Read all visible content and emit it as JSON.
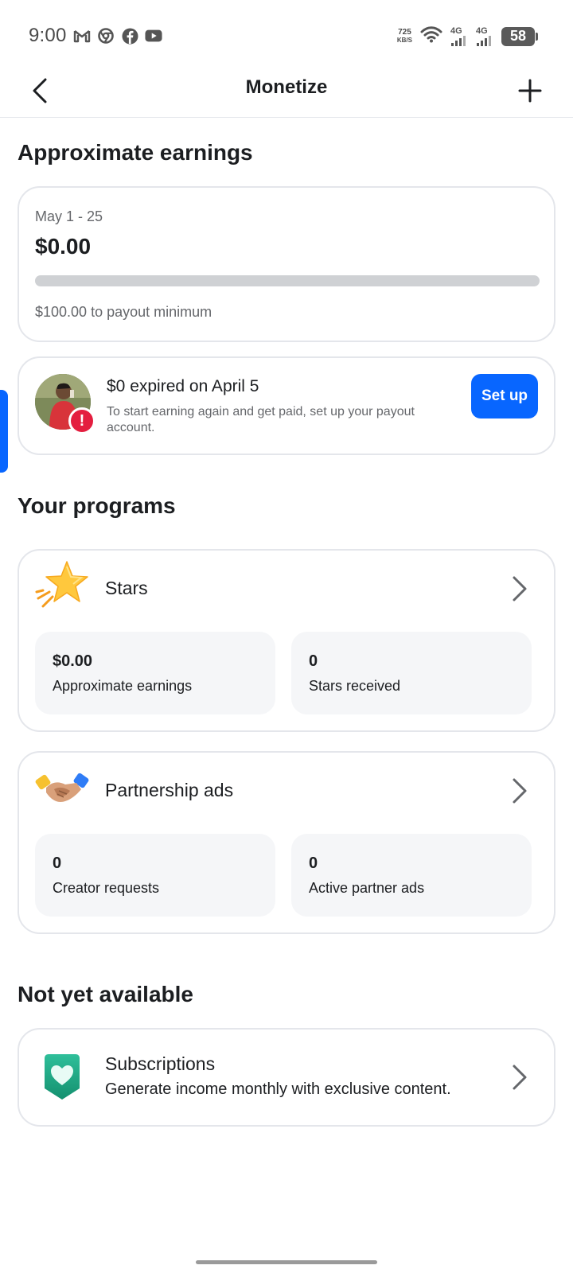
{
  "status_bar": {
    "time": "9:00",
    "net_speed_value": "725",
    "net_speed_unit": "KB/S",
    "network_1": "4G",
    "network_2": "4G",
    "battery": "58",
    "app_icons": [
      "gmail-icon",
      "chrome-icon",
      "facebook-icon",
      "youtube-icon"
    ]
  },
  "header": {
    "title": "Monetize",
    "back_icon": "chevron-left-icon",
    "add_icon": "plus-icon"
  },
  "earnings": {
    "section_title": "Approximate earnings",
    "period": "May 1 - 25",
    "amount": "$0.00",
    "progress_fraction": 0.0,
    "minimum_text": "$100.00 to payout minimum"
  },
  "expired": {
    "title": "$0 expired on April 5",
    "description": "To start earning again and get paid, set up your payout account.",
    "button_label": "Set up",
    "badge": "!"
  },
  "programs": {
    "section_title": "Your programs",
    "stars": {
      "title": "Stars",
      "icon": "star-icon",
      "stat_1_value": "$0.00",
      "stat_1_label": "Approximate earnings",
      "stat_2_value": "0",
      "stat_2_label": "Stars received"
    },
    "partnership": {
      "title": "Partnership ads",
      "icon": "handshake-icon",
      "stat_1_value": "0",
      "stat_1_label": "Creator requests",
      "stat_2_value": "0",
      "stat_2_label": "Active partner ads"
    }
  },
  "not_available": {
    "section_title": "Not yet available",
    "subscriptions": {
      "title": "Subscriptions",
      "description": "Generate income monthly with exclusive content.",
      "icon": "heart-badge-icon"
    }
  },
  "colors": {
    "accent": "#0866ff",
    "alert": "#e41e3f",
    "text_primary": "#1c1e21",
    "text_secondary": "#65676b",
    "border": "#e4e6eb",
    "stat_bg": "#f5f6f8"
  }
}
